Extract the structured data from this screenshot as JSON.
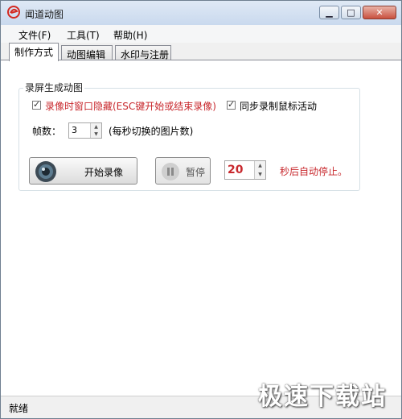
{
  "window": {
    "title": "闻道动图"
  },
  "menu": [
    {
      "label": "文件(F)"
    },
    {
      "label": "工具(T)"
    },
    {
      "label": "帮助(H)"
    }
  ],
  "tabs": [
    {
      "label": "制作方式",
      "active": true
    },
    {
      "label": "动图编辑",
      "active": false
    },
    {
      "label": "水印与注册",
      "active": false
    }
  ],
  "group": {
    "title": "录屏生成动图",
    "hide_window": {
      "label": "录像时窗口隐藏(ESC键开始或结束录像)",
      "checked": true
    },
    "sync_mouse": {
      "label": "同步录制鼠标活动",
      "checked": true
    },
    "fps": {
      "label": "帧数：",
      "value": "3",
      "hint": "(每秒切换的图片数)"
    },
    "start_button": {
      "label": "开始录像"
    },
    "pause_button": {
      "label": "暂停"
    },
    "auto_stop": {
      "value": "20",
      "suffix": "秒后自动停止。"
    }
  },
  "status": {
    "text": "就绪"
  },
  "watermark": {
    "text": "极速下载站"
  },
  "colors": {
    "accent_red": "#c8282d",
    "title_bar": "#c9d9ee"
  }
}
